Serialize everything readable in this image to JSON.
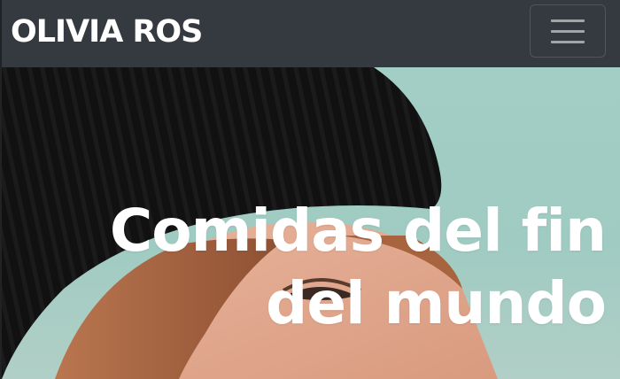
{
  "navbar": {
    "brand": "OLIVIA ROS",
    "toggler_icon": "hamburger-menu-icon"
  },
  "hero": {
    "title_line1": "Comidas del fin",
    "title_line2": "del mundo",
    "image_description_icon": "hero-photo"
  },
  "colors": {
    "navbar_bg": "#343a40",
    "hero_bg": "#a3cec6",
    "title_color": "#ffffff"
  }
}
